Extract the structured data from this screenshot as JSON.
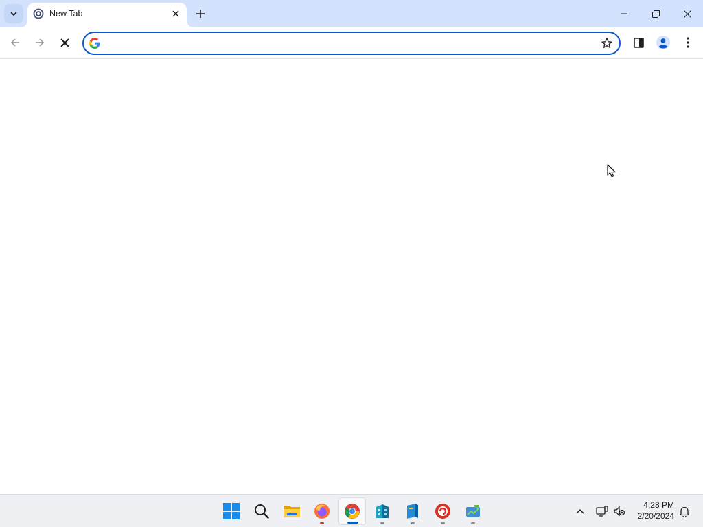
{
  "browser": {
    "tab": {
      "title": "New Tab",
      "favicon": "chrome-newtab-icon"
    },
    "omnibox": {
      "value": "",
      "placeholder": ""
    },
    "accent": "#0b57d0",
    "tabstrip_color": "#d3e3fd"
  },
  "taskbar": {
    "apps": [
      {
        "name": "start",
        "icon": "windows-start-icon"
      },
      {
        "name": "search",
        "icon": "search-icon"
      },
      {
        "name": "file-explorer",
        "icon": "folder-icon"
      },
      {
        "name": "firefox",
        "icon": "firefox-icon"
      },
      {
        "name": "chrome",
        "icon": "chrome-icon",
        "active": true
      },
      {
        "name": "app-blue-building",
        "icon": "building-icon"
      },
      {
        "name": "app-blue-book",
        "icon": "book-icon"
      },
      {
        "name": "app-red-circle",
        "icon": "red-circle-app-icon"
      },
      {
        "name": "app-green-chart",
        "icon": "chart-app-icon"
      }
    ],
    "clock": {
      "time": "4:28 PM",
      "date": "2/20/2024"
    }
  }
}
